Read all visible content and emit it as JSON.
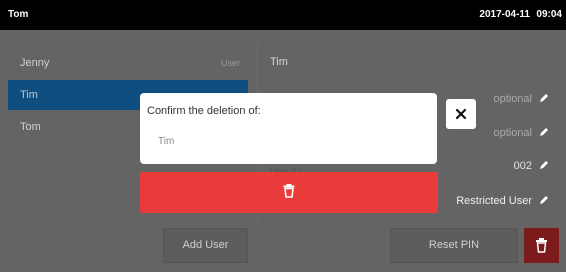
{
  "topbar": {
    "user": "Tom",
    "date": "2017-04-11",
    "time": "09:04"
  },
  "users": [
    {
      "name": "Jenny",
      "role": "User",
      "selected": false
    },
    {
      "name": "Tim",
      "role": "",
      "selected": true
    },
    {
      "name": "Tom",
      "role": "",
      "selected": false
    }
  ],
  "detail": {
    "name": "Tim",
    "field1": "optional",
    "field2": "optional",
    "user_id_label": "User ID",
    "user_id": "002",
    "role": "Restricted User"
  },
  "buttons": {
    "add_user": "Add User",
    "reset_pin": "Reset PIN"
  },
  "dialog": {
    "title": "Confirm the deletion of:",
    "value": "Tim",
    "confirm_icon": "trash-icon",
    "close_icon": "close-icon"
  },
  "colors": {
    "danger": "#ea3b3b",
    "danger_dark": "#7b1b1b",
    "selected_row": "#0f4e7f"
  }
}
